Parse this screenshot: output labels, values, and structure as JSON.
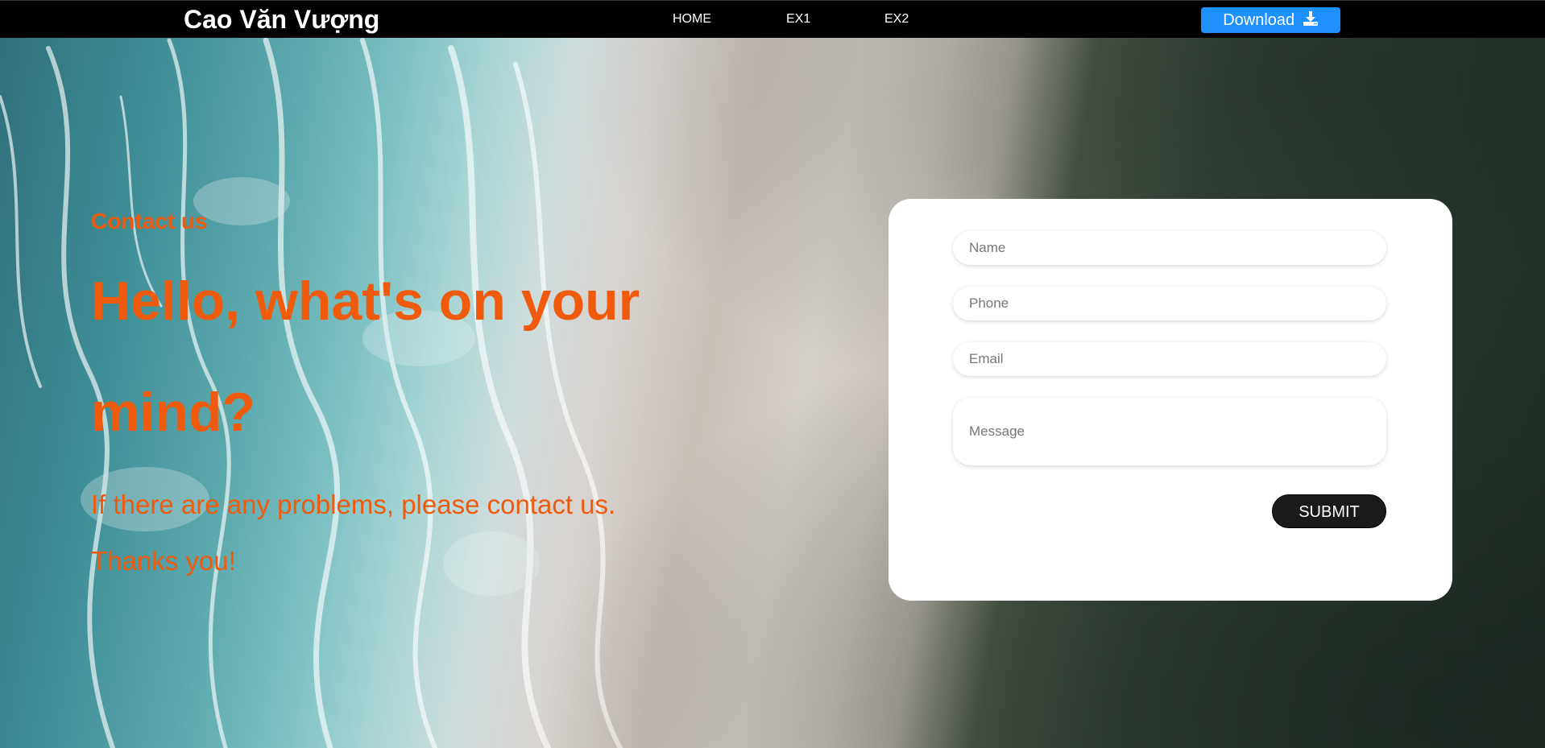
{
  "header": {
    "brand": "Cao Văn Vượng",
    "nav": {
      "home": "HOME",
      "ex1": "EX1",
      "ex2": "EX2"
    },
    "download_label": "Download",
    "download_icon": "download-icon",
    "download_color": "#1e90ff"
  },
  "hero": {
    "eyebrow": "Contact us",
    "headline": "Hello, what's on your mind?",
    "line1": "If there are any problems, please contact us.",
    "line2": "Thanks you!",
    "accent_color": "#f05a0c"
  },
  "form": {
    "name_placeholder": "Name",
    "phone_placeholder": "Phone",
    "email_placeholder": "Email",
    "message_placeholder": "Message",
    "submit_label": "SUBMIT"
  }
}
